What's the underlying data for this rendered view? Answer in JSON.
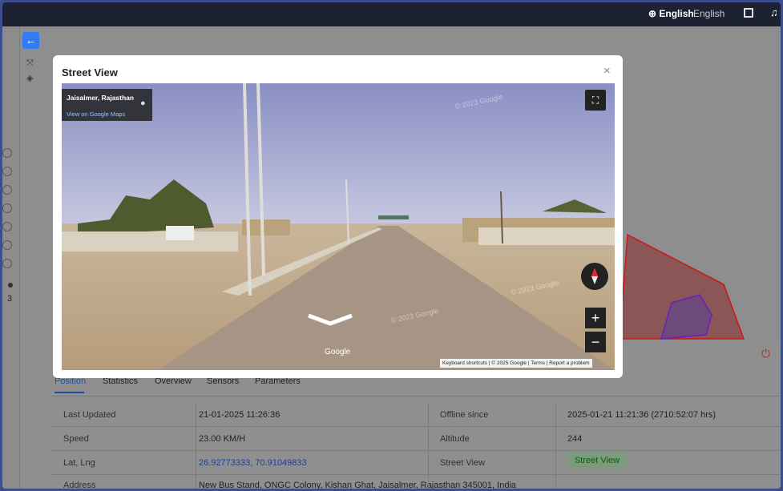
{
  "topbar": {
    "lang_selected": "English",
    "lang_option": "English",
    "icons": [
      "globe-icon",
      "fullscreen-icon",
      "bell-icon"
    ]
  },
  "sidebar": {
    "icons": [
      "back-arrow-icon",
      "expand-icon",
      "layers-icon"
    ],
    "count": "3"
  },
  "modal": {
    "title": "Street View",
    "close": "×",
    "location": "Jaisalmer, Rajasthan",
    "maps_link": "View on Google Maps",
    "google": "Google",
    "watermark": "© 2023 Google",
    "attribution": "Keyboard shortcuts | © 2025 Google | Terms | Report a problem",
    "zoom_in": "+",
    "zoom_out": "−"
  },
  "tabs": [
    "Position",
    "Statistics",
    "Overview",
    "Sensors",
    "Parameters"
  ],
  "details": {
    "last_updated_label": "Last Updated",
    "last_updated": "21-01-2025 11:26:36",
    "offline_label": "Offline since",
    "offline": "2025-01-21 11:21:36 (2710:52:07 hrs)",
    "speed_label": "Speed",
    "speed": "23.00 KM/H",
    "altitude_label": "Altitude",
    "altitude": "244",
    "latlng_label": "Lat, Lng",
    "latlng": "26.92773333, 70.91049833",
    "street_view_label": "Street View",
    "street_view_button": "Street View",
    "address_label": "Address",
    "address": "New Bus Stand, ONGC Colony, Kishan Ghat, Jaisalmer, Rajasthan 345001, India"
  },
  "colors": {
    "accent": "#2f7df6",
    "topbar": "#1d2233",
    "link": "#1e3f9a",
    "polygon_red": "#d11414",
    "polygon_purple": "#6a1fc0"
  }
}
